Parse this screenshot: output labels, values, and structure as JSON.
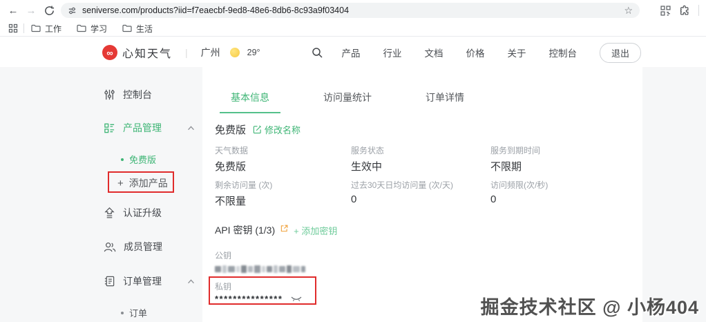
{
  "browser": {
    "url": "seniverse.com/products?iid=f7eaecbf-9ed8-48e6-8db6-8c93a9f03404",
    "icons": {
      "back": "←",
      "forward": "→",
      "star": "☆"
    },
    "bookmarks": [
      "工作",
      "学习",
      "生活"
    ]
  },
  "site_header": {
    "brand": "心知天气",
    "logo_glyph": "∞",
    "location": "广州",
    "temperature": "29°",
    "nav": [
      "产品",
      "行业",
      "文档",
      "价格",
      "关于",
      "控制台"
    ],
    "logout_label": "退出"
  },
  "sidebar": {
    "console": "控制台",
    "product_mgmt": "产品管理",
    "free_version": "免费版",
    "add_product_plus": "+",
    "add_product": "添加产品",
    "cert_upgrade": "认证升级",
    "member_mgmt": "成员管理",
    "order_mgmt": "订单管理",
    "order": "订单"
  },
  "main": {
    "tabs": [
      {
        "label": "基本信息",
        "active": true
      },
      {
        "label": "访问量统计",
        "active": false
      },
      {
        "label": "订单详情",
        "active": false
      }
    ],
    "product_title": "免费版",
    "rename_link": "修改名称",
    "fields": [
      {
        "label": "天气数据",
        "value": "免费版"
      },
      {
        "label": "服务状态",
        "value": "生效中"
      },
      {
        "label": "服务到期时间",
        "value": "不限期"
      },
      {
        "label": "剩余访问量 (次)",
        "value": "不限量"
      },
      {
        "label": "过去30天日均访问量 (次/天)",
        "value": "0"
      },
      {
        "label": "访问频限(次/秒)",
        "value": "0"
      }
    ],
    "api_keys": {
      "title": "API 密钥 (1/3)",
      "add_key_label": "+ 添加密钥",
      "public_key_label": "公钥",
      "private_key_label": "私钥",
      "private_key_masked": "***************"
    }
  },
  "watermark": "掘金技术社区 @ 小杨404",
  "colors": {
    "accent_green": "#3eb575",
    "annotation_red": "#e02b2b",
    "logo_red": "#e53935",
    "sun_yellow": "#f6c943"
  }
}
